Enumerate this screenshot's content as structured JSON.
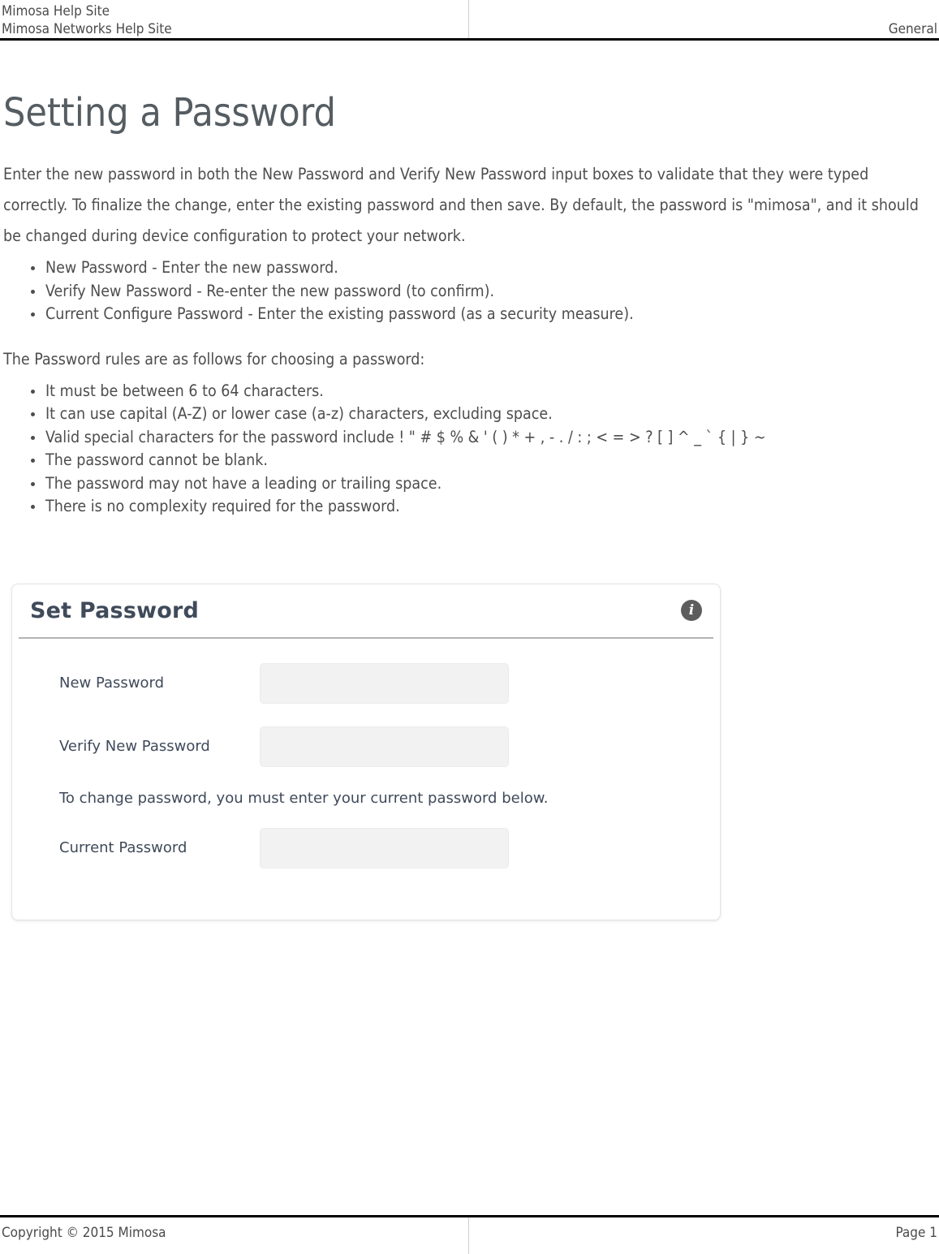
{
  "header": {
    "left_line_1": "Mimosa Help Site",
    "left_line_2": "Mimosa Networks Help Site",
    "right_label": "General"
  },
  "article": {
    "title": "Setting a Password",
    "intro": "Enter the new password in both the New Password and Verify New Password input boxes to validate that they were typed correctly. To finalize the change, enter the existing password and then save. By default, the password is \"mimosa\", and it should be changed during device configuration to protect your network.",
    "field_bullets": [
      "New Password - Enter the new password.",
      "Verify New Password - Re-enter the new password (to confirm).",
      "Current Configure Password - Enter the existing password (as a security measure)."
    ],
    "rules_intro": "The Password rules are as follows for choosing a password:",
    "rule_bullets": [
      "It must be between 6 to 64 characters.",
      "It can use capital (A-Z) or lower case (a-z) characters, excluding space.",
      "Valid special characters for the password include ! \" # $ % & ' ( ) * + , - . / : ; < = > ? [ ] ^ _ ` { | } ~",
      "The password cannot be blank.",
      "The password may not have a leading or trailing space.",
      "There is no complexity required for the password."
    ]
  },
  "set_password_card": {
    "title": "Set Password",
    "info_icon_glyph": "i",
    "info_icon_name": "info-icon",
    "fields": [
      {
        "label": "New Password",
        "value": "",
        "placeholder": ""
      },
      {
        "label": "Verify New Password",
        "value": "",
        "placeholder": ""
      }
    ],
    "hint": "To change password, you must enter your current password below.",
    "current_field": {
      "label": "Current Password",
      "value": "",
      "placeholder": ""
    },
    "colors": {
      "title_text": "#3f4a5a",
      "input_background": "#f2f2f2",
      "rule": "#b3b3b3",
      "info_icon_background": "#5d5d5d"
    }
  },
  "footer": {
    "copyright": "Copyright © 2015 Mimosa",
    "page_number": "Page 1"
  }
}
